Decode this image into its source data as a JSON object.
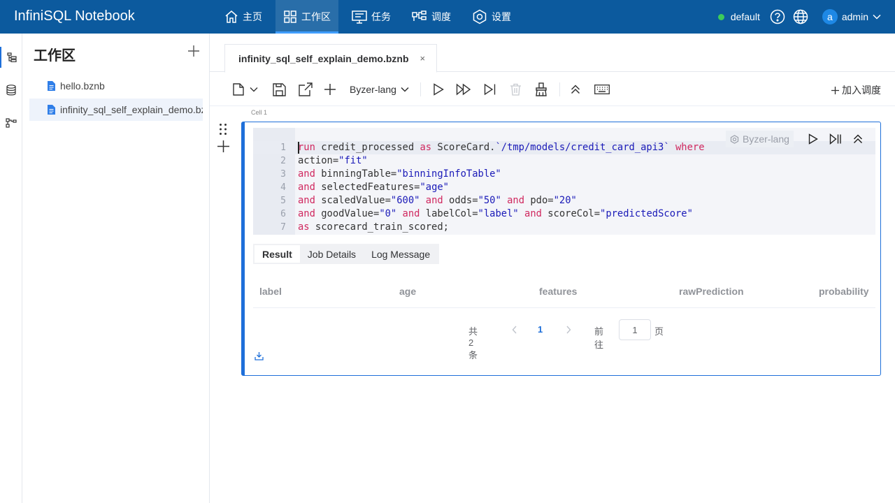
{
  "app": {
    "title": "InfiniSQL Notebook"
  },
  "nav": [
    {
      "label": "主页",
      "icon": "home-icon"
    },
    {
      "label": "工作区",
      "icon": "grid-icon",
      "active": true
    },
    {
      "label": "任务",
      "icon": "monitor-icon"
    },
    {
      "label": "调度",
      "icon": "schedule-icon"
    },
    {
      "label": "设置",
      "icon": "gear-icon"
    }
  ],
  "header": {
    "env": "default",
    "user_initial": "a",
    "user_name": "admin",
    "status_color": "#3ccb5a"
  },
  "sidebar": {
    "title": "工作区",
    "files": [
      {
        "name": "hello.bznb"
      },
      {
        "name": "infinity_sql_self_explain_demo.bznb",
        "selected": true
      }
    ]
  },
  "tab": {
    "name": "infinity_sql_self_explain_demo.bznb",
    "close": "×"
  },
  "toolbar": {
    "language": "Byzer-lang",
    "schedule_label": "加入调度"
  },
  "cell": {
    "label": "Cell 1",
    "language": "Byzer-lang",
    "lines": [
      {
        "n": "1",
        "tokens": [
          [
            "kw",
            "run"
          ],
          [
            "",
            "credit_processed "
          ],
          [
            "kw",
            "as"
          ],
          [
            "",
            "ScoreCard."
          ],
          [
            "str",
            "`/tmp/models/credit_card_api3`"
          ],
          [
            "",
            ""
          ],
          [
            "kw",
            " where"
          ]
        ]
      },
      {
        "n": "2",
        "tokens": [
          [
            "",
            "action="
          ],
          [
            "str",
            "\"fit\""
          ]
        ]
      },
      {
        "n": "3",
        "tokens": [
          [
            "kw",
            "and"
          ],
          [
            "",
            "binningTable="
          ],
          [
            "str",
            "\"binningInfoTable\""
          ]
        ]
      },
      {
        "n": "4",
        "tokens": [
          [
            "kw",
            "and"
          ],
          [
            "",
            "selectedFeatures="
          ],
          [
            "str",
            "\"age\""
          ]
        ]
      },
      {
        "n": "5",
        "tokens": [
          [
            "kw",
            "and"
          ],
          [
            "",
            "scaledValue="
          ],
          [
            "str",
            "\"600\""
          ],
          [
            "",
            ""
          ],
          [
            "kw",
            " and"
          ],
          [
            "",
            "odds="
          ],
          [
            "str",
            "\"50\""
          ],
          [
            "",
            ""
          ],
          [
            "kw",
            " and"
          ],
          [
            "",
            "pdo="
          ],
          [
            "str",
            "\"20\""
          ]
        ]
      },
      {
        "n": "6",
        "tokens": [
          [
            "kw",
            "and"
          ],
          [
            "",
            "goodValue="
          ],
          [
            "str",
            "\"0\""
          ],
          [
            "",
            ""
          ],
          [
            "kw",
            " and"
          ],
          [
            "",
            "labelCol="
          ],
          [
            "str",
            "\"label\""
          ],
          [
            "",
            ""
          ],
          [
            "kw",
            " and"
          ],
          [
            "",
            "scoreCol="
          ],
          [
            "str",
            "\"predictedScore\""
          ]
        ]
      },
      {
        "n": "7",
        "tokens": [
          [
            "kw",
            "as"
          ],
          [
            "",
            "scorecard_train_scored;"
          ]
        ]
      }
    ]
  },
  "result": {
    "tabs": [
      "Result",
      "Job Details",
      "Log Message"
    ],
    "columns": [
      "label",
      "age",
      "features",
      "rawPrediction",
      "probability"
    ],
    "pager": {
      "total": "共 2 条",
      "page": "1",
      "goto": "前往",
      "input": "1",
      "suffix": "页"
    }
  },
  "colors": {
    "brand": "#0c5a9e",
    "accent": "#1e6fd9",
    "keyword": "#d0285f",
    "string": "#1a1ab8"
  }
}
